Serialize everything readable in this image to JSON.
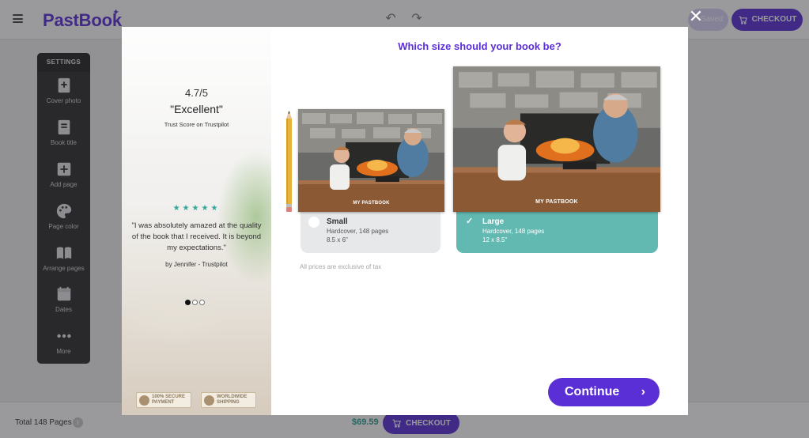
{
  "header": {
    "logo": "PastBook",
    "saved_label": "Saved",
    "checkout_label": "CHECKOUT",
    "icons": {
      "menu": "hamburger-menu-icon",
      "undo": "undo-icon",
      "redo": "redo-icon",
      "cart": "cart-icon"
    }
  },
  "settings": {
    "title": "SETTINGS",
    "items": [
      {
        "label": "Cover photo",
        "icon": "cover-photo-icon"
      },
      {
        "label": "Book title",
        "icon": "book-title-icon"
      },
      {
        "label": "Add page",
        "icon": "add-page-icon"
      },
      {
        "label": "Page color",
        "icon": "palette-icon"
      },
      {
        "label": "Arrange pages",
        "icon": "book-open-icon"
      },
      {
        "label": "Dates",
        "icon": "calendar-icon"
      },
      {
        "label": "More",
        "icon": "more-dots-icon"
      }
    ]
  },
  "bottom": {
    "total_pages": "Total 148 Pages",
    "info_icon": "i",
    "price": "$69.59",
    "checkout_label": "CHECKOUT"
  },
  "modal": {
    "testimonial": {
      "rating": "4.7/5",
      "rating_word": "\"Excellent\"",
      "trust_line": "Trust Score on Trustpilot",
      "stars": "★★★★★",
      "quote": "\"I was absolutely amazed at the quality of the book that I received. It is beyond my expectations.\"",
      "author": "by Jennifer - Trustpilot"
    },
    "badges": [
      {
        "line1": "100% Secure",
        "line2": "Payment",
        "icon": "lock-icon"
      },
      {
        "line1": "Worldwide",
        "line2": "Shipping",
        "icon": "truck-icon"
      }
    ],
    "question": "Which size should your book be?",
    "cover_title": "MY PASTBOOK",
    "options": [
      {
        "name": "Small",
        "desc": "Hardcover, 148 pages",
        "dims": "8.5 x 6\"",
        "selected": false
      },
      {
        "name": "Large",
        "desc": "Hardcover, 148 pages",
        "dims": "12 x 8.5\"",
        "selected": true
      }
    ],
    "tax_note": "All prices are exclusive of tax",
    "continue_label": "Continue",
    "close_icon": "close-icon"
  },
  "colors": {
    "brand": "#5b2fd6",
    "selected": "#62b9b1",
    "price": "#2e9c8e",
    "stars": "#2fa69b"
  }
}
